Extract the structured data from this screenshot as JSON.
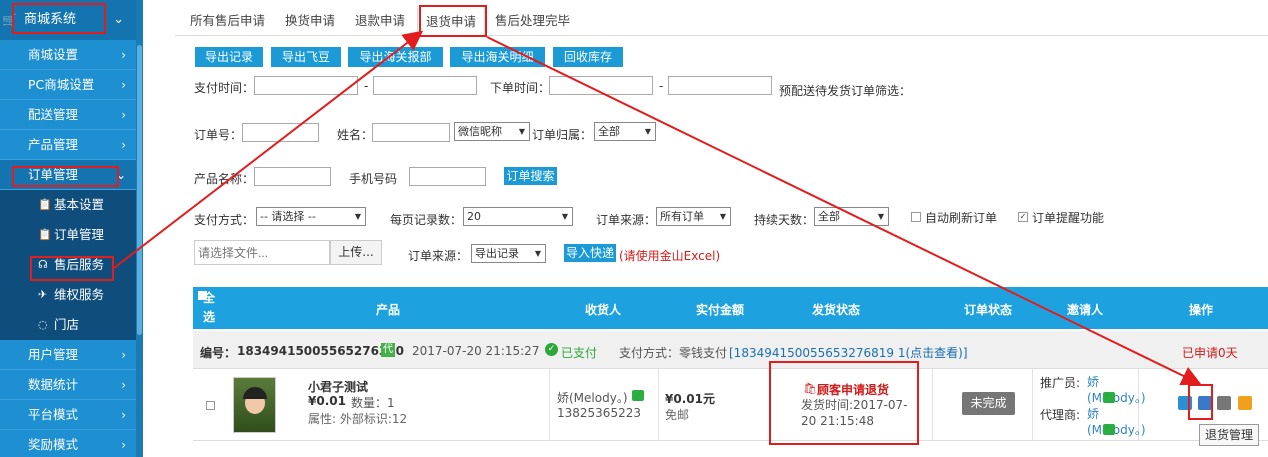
{
  "sidebar": {
    "top_item": "商城系统",
    "items": [
      "商城设置",
      "PC商城设置",
      "配送管理",
      "产品管理",
      "订单管理"
    ],
    "sub_items": [
      "基本设置",
      "订单管理",
      "售后服务",
      "维权服务",
      "门店"
    ],
    "items_after": [
      "用户管理",
      "数据统计",
      "平台模式",
      "奖励模式"
    ]
  },
  "tabs": [
    "所有售后申请",
    "换货申请",
    "退款申请",
    "退货申请",
    "售后处理完毕"
  ],
  "toolbar": [
    "导出记录",
    "导出飞豆",
    "导出海关报部",
    "导出海关明细",
    "回收库存"
  ],
  "filters": {
    "pay_time": "支付时间：",
    "order_time": "下单时间：",
    "presale_filter": "预配送待发货订单筛选：",
    "order_no": "订单号：",
    "name": "姓名：",
    "wechat_nick": "微信昵称",
    "order_owner": "订单归属：",
    "owner_value": "全部",
    "product_name": "产品名称：",
    "phone": "手机号码",
    "search_btn": "订单搜索",
    "pay_method": "支付方式：",
    "pay_method_value": "-- 请选择 --",
    "per_page": "每页记录数：",
    "per_page_value": "20",
    "order_source": "订单来源：",
    "order_source_value": "所有订单",
    "days": "持续天数：",
    "days_value": "全部",
    "auto_refresh": "自动刷新订单",
    "reminder": "订单提醒功能",
    "file_placeholder": "请选择文件...",
    "upload_btn": "上传...",
    "source2": "订单来源：",
    "source2_value": "导出记录",
    "import_btn": "导入快递",
    "import_hint": "(请使用金山Excel)"
  },
  "table": {
    "select_all": "全选",
    "headers": [
      "产品",
      "收货人",
      "实付金额",
      "发货状态",
      "订单状态",
      "邀请人",
      "操作"
    ]
  },
  "order": {
    "no_label": "编号：",
    "no": "18349415005565276380",
    "badge": "代",
    "time": "2017-07-20 21:15:27",
    "paid": "已支付",
    "pay_method": "支付方式：零钱支付",
    "txn": "[183494150055653276819 1(点击查看)]",
    "applied": "已申请0天",
    "product_title": "小君子测试",
    "price": "¥0.01",
    "qty": "数量：1",
    "attr": "属性: 外部标识:12",
    "receiver": "娇(Melody。)",
    "phone": "13825365223",
    "amount": "¥0.01元",
    "shipping_fee": "免邮",
    "ship_status": "顾客申请退货",
    "ship_time": "发货时间:2017-07-20 21:15:48",
    "order_status": "未完成",
    "promoter_label": "推广员:",
    "promoter": "娇(Melody。)",
    "agent_label": "代理商:",
    "agent": "娇(Melody。)",
    "tooltip": "退货管理"
  }
}
